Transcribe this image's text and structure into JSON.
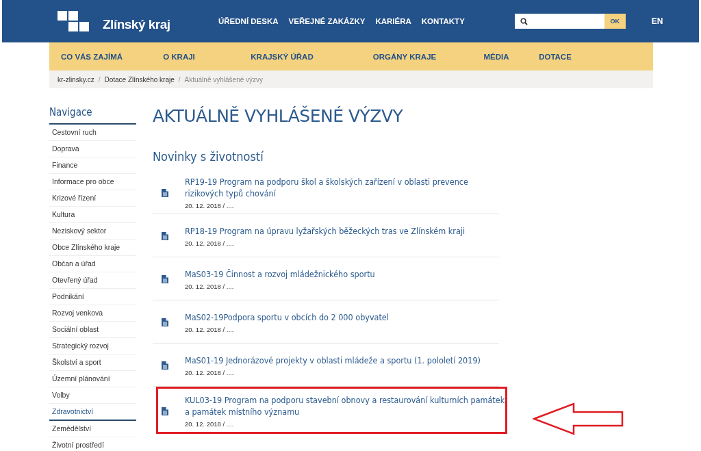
{
  "header": {
    "logo": "Zlínský kraj",
    "top_links": [
      "ÚŘEDNÍ DESKA",
      "VEŘEJNÉ ZAKÁZKY",
      "KARIÉRA",
      "KONTAKTY"
    ],
    "search": {
      "button": "OK"
    },
    "language": "EN"
  },
  "main_nav": [
    "CO VÁS ZAJÍMÁ",
    "O KRAJI",
    "KRAJSKÝ ÚŘAD",
    "ORGÁNY KRAJE",
    "MÉDIA",
    "DOTACE"
  ],
  "breadcrumb": [
    "kr-zlinsky.cz",
    "Dotace Zlínského kraje",
    "Aktuálně vyhlášené výzvy"
  ],
  "breadcrumb_separator": "/",
  "sidebar": {
    "title": "Navigace",
    "items": [
      {
        "label": "Cestovní ruch",
        "selected": false
      },
      {
        "label": "Doprava",
        "selected": false
      },
      {
        "label": "Finance",
        "selected": false
      },
      {
        "label": "Informace pro obce",
        "selected": false
      },
      {
        "label": "Krizové řízení",
        "selected": false
      },
      {
        "label": "Kultura",
        "selected": false
      },
      {
        "label": "Neziskový sektor",
        "selected": false
      },
      {
        "label": "Obce Zlínského kraje",
        "selected": false
      },
      {
        "label": "Občan a úřad",
        "selected": false
      },
      {
        "label": "Otevřený úřad",
        "selected": false
      },
      {
        "label": "Podnikání",
        "selected": false
      },
      {
        "label": "Rozvoj venkova",
        "selected": false
      },
      {
        "label": "Sociální oblast",
        "selected": false
      },
      {
        "label": "Strategický rozvoj",
        "selected": false
      },
      {
        "label": "Školství a sport",
        "selected": false
      },
      {
        "label": "Územní plánování",
        "selected": false
      },
      {
        "label": "Volby",
        "selected": false
      },
      {
        "label": "Zdravotnictví",
        "selected": true
      },
      {
        "label": "Zemědělství",
        "selected": false
      },
      {
        "label": "Životní prostředí",
        "selected": false
      }
    ]
  },
  "page_title": "AKTUÁLNĚ VYHLÁŠENÉ VÝZVY",
  "section_title": "Novinky s životností",
  "items": [
    {
      "title": "RP19-19 Program na podporu škol a školských zařízení v oblasti prevence rizikových typů chování",
      "meta": "20. 12. 2018 / ....",
      "highlighted": false
    },
    {
      "title": "RP18-19 Program na úpravu lyžařských běžeckých tras ve Zlínském kraji",
      "meta": "20. 12. 2018 / ....",
      "highlighted": false
    },
    {
      "title": "MaS03-19 Činnost a rozvoj mládežnického sportu",
      "meta": "20. 12. 2018 / ....",
      "highlighted": false
    },
    {
      "title": "MaS02-19Podpora sportu v obcích do 2 000 obyvatel",
      "meta": "20. 12. 2018 / ....",
      "highlighted": false
    },
    {
      "title": "MaS01-19 Jednorázové projekty v oblasti mládeže a sportu (1. pololetí 2019)",
      "meta": "20. 12. 2018 / ....",
      "highlighted": false
    },
    {
      "title": "KUL03-19 Program na podporu stavební obnovy a restaurování kulturních památek a památek místního významu",
      "meta": "20. 12. 2018 / ....",
      "highlighted": true
    }
  ]
}
